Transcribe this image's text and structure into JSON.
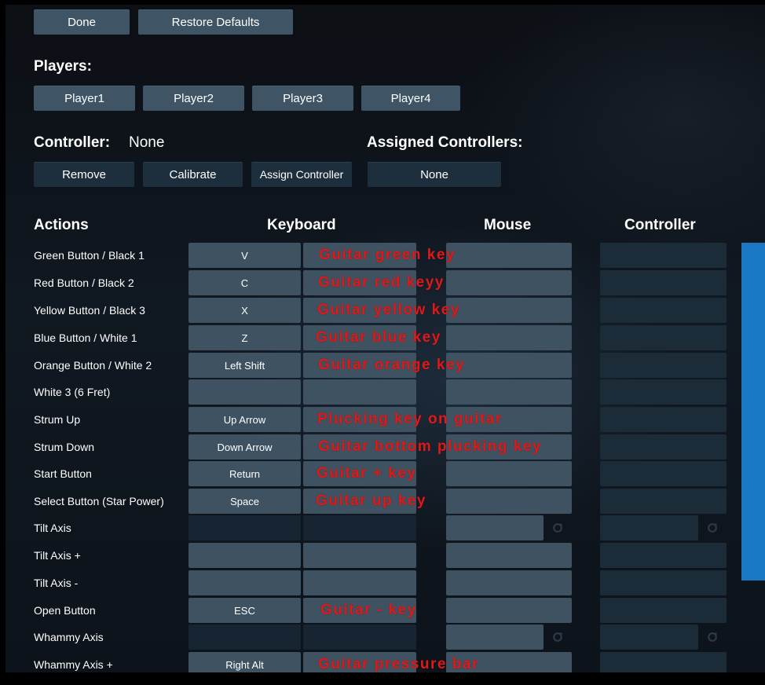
{
  "top_buttons": {
    "done": "Done",
    "restore": "Restore Defaults"
  },
  "players": {
    "heading": "Players:",
    "items": [
      "Player1",
      "Player2",
      "Player3",
      "Player4"
    ]
  },
  "controller": {
    "heading": "Controller:",
    "value": "None",
    "remove": "Remove",
    "calibrate": "Calibrate",
    "assign": "Assign Controller"
  },
  "assigned": {
    "heading": "Assigned Controllers:",
    "value": "None"
  },
  "columns": {
    "actions": "Actions",
    "keyboard": "Keyboard",
    "mouse": "Mouse",
    "controller": "Controller"
  },
  "rows": [
    {
      "label": "Green Button / Black 1",
      "key": "V",
      "annotation": "Guitar green key"
    },
    {
      "label": "Red Button / Black 2",
      "key": "C",
      "annotation": "Guitar red keyy"
    },
    {
      "label": "Yellow Button / Black 3",
      "key": "X",
      "annotation": "Guitar yellow key"
    },
    {
      "label": "Blue Button / White 1",
      "key": "Z",
      "annotation": "Guitar blue key"
    },
    {
      "label": "Orange Button / White 2",
      "key": "Left Shift",
      "annotation": "Guitar orange key"
    },
    {
      "label": "White 3 (6 Fret)",
      "key": "",
      "annotation": ""
    },
    {
      "label": "Strum Up",
      "key": "Up Arrow",
      "annotation": "Plucking key on guitar"
    },
    {
      "label": "Strum Down",
      "key": "Down Arrow",
      "annotation": "Guitar bottom plucking key"
    },
    {
      "label": "Start Button",
      "key": "Return",
      "annotation": "Guitar + key"
    },
    {
      "label": "Select Button (Star Power)",
      "key": "Space",
      "annotation": "Guitar up key"
    },
    {
      "label": "Tilt Axis",
      "key": "",
      "annotation": ""
    },
    {
      "label": "Tilt Axis +",
      "key": "",
      "annotation": ""
    },
    {
      "label": "Tilt Axis -",
      "key": "",
      "annotation": ""
    },
    {
      "label": "Open Button",
      "key": "ESC",
      "annotation": "Guitar - key"
    },
    {
      "label": "Whammy Axis",
      "key": "",
      "annotation": ""
    },
    {
      "label": "Whammy Axis +",
      "key": "Right Alt",
      "annotation": "Guitar pressure bar"
    }
  ],
  "colors": {
    "button": "#3f5566",
    "annotation": "#e01818",
    "side_panel": "#1a78c2"
  }
}
